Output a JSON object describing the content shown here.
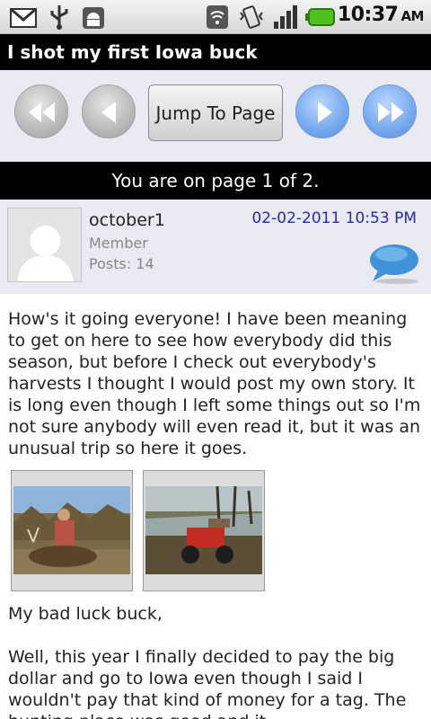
{
  "status_bar": {
    "icons": [
      "gmail-icon",
      "usb-icon",
      "android-debug-icon",
      "wifi-icon",
      "vibrate-icon",
      "signal-icon",
      "battery-icon"
    ],
    "time": "10:37",
    "ampm": "AM"
  },
  "thread": {
    "title": "I shot my first Iowa buck"
  },
  "navigation": {
    "first_icon": "rewind-icon",
    "prev_icon": "back-icon",
    "jump_label": "Jump To Page",
    "next_icon": "forward-icon",
    "last_icon": "fast-forward-icon",
    "page_indicator": "You are on page 1 of 2."
  },
  "post": {
    "username": "october1",
    "role": "Member",
    "posts": "Posts: 14",
    "date": "02-02-2011 10:53 PM",
    "paragraph1": "How's it going everyone! I have been meaning to get on here to see how everybody did this season, but before I check out everybody's harvests I thought I would post my own story. It is long even though I left some things out so I'm not sure anybody will even read it, but it was an unusual trip so here it goes.",
    "paragraph2": "My bad luck buck,",
    "paragraph3": "Well, this year I finally decided to pay the big dollar and go to Iowa even though I said I wouldn't pay that kind of money for a tag. The hunting place was good and it..."
  },
  "colors": {
    "header_bg": "#000000",
    "nav_bg": "#e9eaf2",
    "date_color": "#2a2ab0",
    "nav_active": "#76a8ee",
    "nav_inactive": "#b5b5b5"
  }
}
